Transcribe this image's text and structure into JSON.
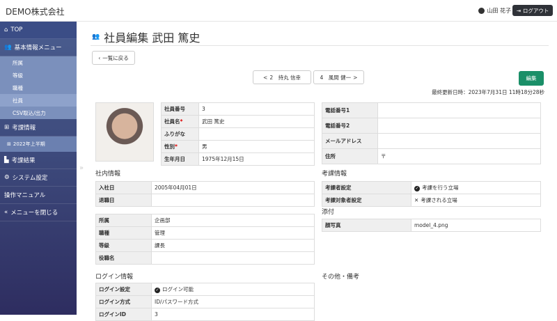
{
  "header": {
    "brand": "DEMO株式会社",
    "user_name": "山田 花子",
    "logout_label": "ログアウト"
  },
  "sidebar": {
    "top": "TOP",
    "basic_menu": "基本情報メニュー",
    "basic_items": [
      "所属",
      "等級",
      "職種",
      "社員",
      "CSV取込/出力"
    ],
    "review_info": "考課情報",
    "review_period": "2022年上半期",
    "review_result": "考課結果",
    "system": "システム設定",
    "manual": "操作マニュアル",
    "close_menu": "メニューを閉じる"
  },
  "page": {
    "title": "社員編集 武田 篤史",
    "back_label": "一覧に戻る",
    "prev_label": "2　持丸 信幸",
    "next_label": "4　風間 健一",
    "edit_label": "編集",
    "updated": "最終更新日時：2023年7月31日 11時18分28秒"
  },
  "profile": {
    "rows": [
      {
        "label": "社員番号",
        "value": "3",
        "required": false
      },
      {
        "label": "社員名",
        "value": "武田 篤史",
        "required": true
      },
      {
        "label": "ふりがな",
        "value": "",
        "required": false
      },
      {
        "label": "性別",
        "value": "男",
        "required": true
      },
      {
        "label": "生年月日",
        "value": "1975年12月15日",
        "required": false
      }
    ]
  },
  "contact": {
    "rows": [
      {
        "label": "電話番号1",
        "value": ""
      },
      {
        "label": "電話番号2",
        "value": ""
      },
      {
        "label": "メールアドレス",
        "value": ""
      },
      {
        "label": "住所",
        "value": "〒"
      }
    ]
  },
  "company": {
    "heading": "社内情報",
    "dates": [
      {
        "label": "入社日",
        "value": "2005年04月01日"
      },
      {
        "label": "退職日",
        "value": ""
      }
    ],
    "org": [
      {
        "label": "所属",
        "value": "企画部"
      },
      {
        "label": "職種",
        "value": "管理"
      },
      {
        "label": "等級",
        "value": "課長"
      },
      {
        "label": "役職名",
        "value": ""
      }
    ]
  },
  "review": {
    "heading": "考課情報",
    "rows": [
      {
        "label": "考課者設定",
        "value": "考課を行う立場",
        "icon": "check-circle-icon"
      },
      {
        "label": "考課対象者設定",
        "value": "考課される立場",
        "icon": "x-icon"
      }
    ]
  },
  "attachment": {
    "heading": "添付",
    "rows": [
      {
        "label": "顔写真",
        "value": "model_4.png"
      }
    ]
  },
  "login": {
    "heading": "ログイン情報",
    "rows": [
      {
        "label": "ログイン設定",
        "value": "ログイン可能",
        "icon": "check-circle-icon"
      },
      {
        "label": "ログイン方式",
        "value": "ID/パスワード方式"
      },
      {
        "label": "ログインID",
        "value": "3"
      }
    ]
  },
  "notes": {
    "heading": "その他・備考"
  }
}
